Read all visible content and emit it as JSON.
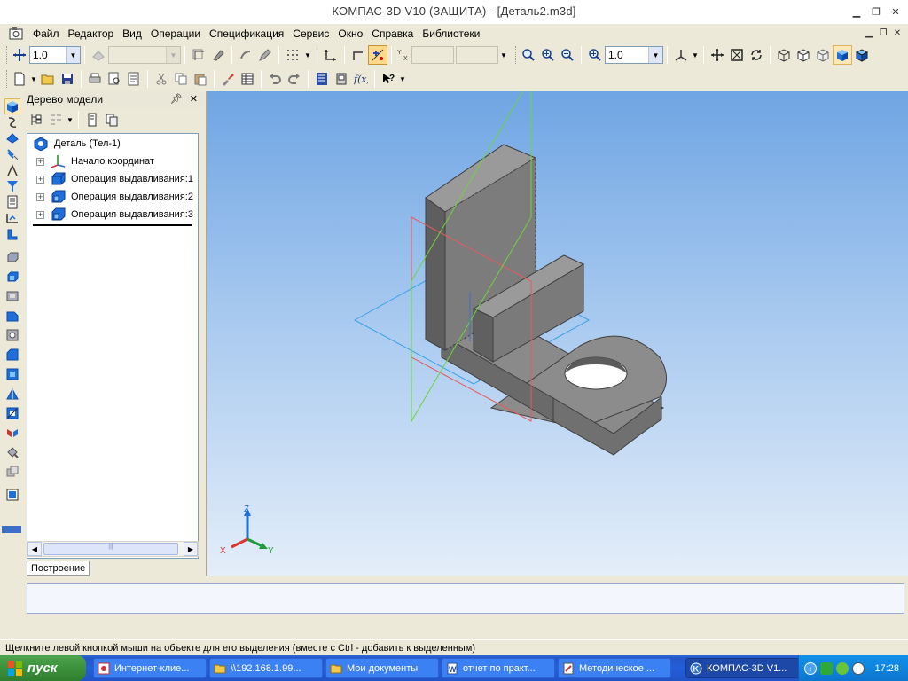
{
  "window": {
    "title": "КОМПАС-3D V10 (ЗАЩИТА) - [Деталь2.m3d]"
  },
  "menu": [
    "Файл",
    "Редактор",
    "Вид",
    "Операции",
    "Спецификация",
    "Сервис",
    "Окно",
    "Справка",
    "Библиотеки"
  ],
  "toolbar": {
    "step_value": "1.0",
    "zoom_value": "1.0"
  },
  "tree_panel": {
    "title": "Дерево модели",
    "root": "Деталь (Тел-1)",
    "items": [
      {
        "label": "Начало координат",
        "icon": "origin-icon"
      },
      {
        "label": "Операция выдавливания:1",
        "icon": "extrude-icon"
      },
      {
        "label": "Операция выдавливания:2",
        "icon": "extrude-icon"
      },
      {
        "label": "Операция выдавливания:3",
        "icon": "extrude-icon"
      }
    ],
    "tab": "Построение"
  },
  "axes": {
    "x": "X",
    "y": "Y",
    "z": "Z"
  },
  "status_text": "Щелкните левой кнопкой мыши на объекте для его выделения (вместе с Ctrl - добавить к выделенным)",
  "taskbar": {
    "start": "пуск",
    "tasks": [
      {
        "label": "Интернет-клие...",
        "active": false
      },
      {
        "label": "\\\\192.168.1.99...",
        "active": false
      },
      {
        "label": "Мои документы",
        "active": false
      },
      {
        "label": "отчет по практ...",
        "active": false
      },
      {
        "label": "Методическое ...",
        "active": false
      },
      {
        "label": "КОМПАС-3D V1...",
        "active": true
      }
    ],
    "clock": "17:28"
  },
  "colors": {
    "viewport_top": "#6fa5e3",
    "viewport_bottom": "#e4eef9",
    "part_face": "#7a7a7a",
    "plane_xy": "#3aa0e8",
    "plane_xz": "#e85a5a",
    "plane_yz": "#6ad63a"
  }
}
